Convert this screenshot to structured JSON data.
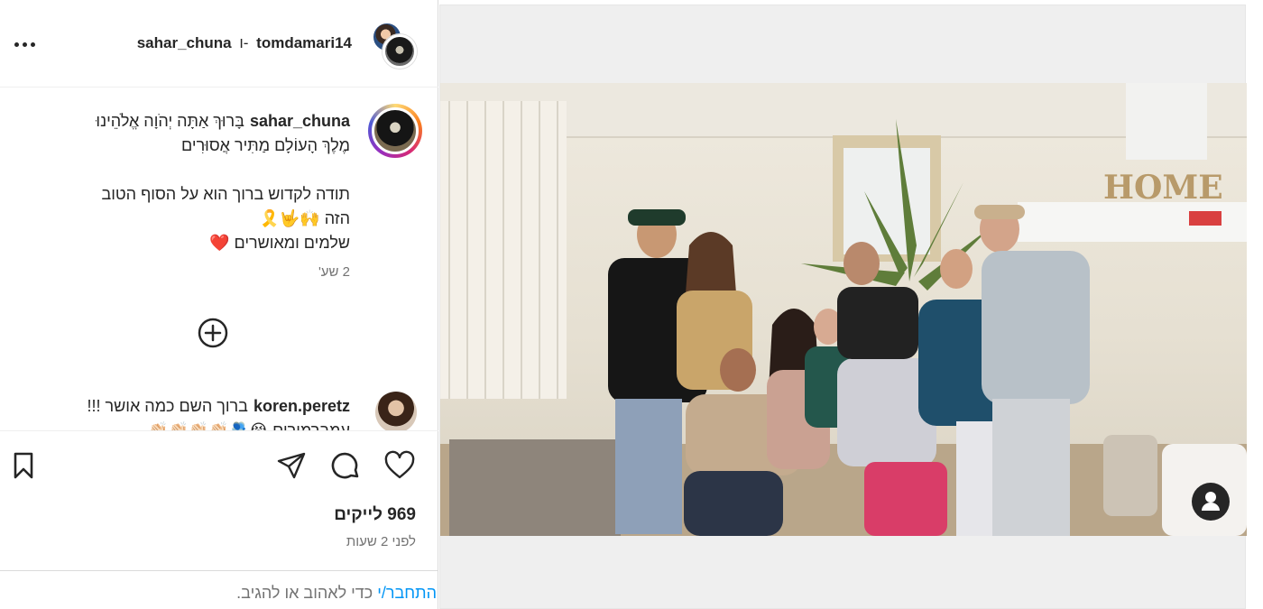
{
  "post": {
    "header": {
      "user1": "sahar_chuna",
      "separator": "ו-",
      "user2": "tomdamari14"
    },
    "caption": {
      "username": "sahar_chuna",
      "line1": "בָּרוּךְ אַתָּה יְהֹוָה אֱלֹהֵינוּ",
      "line2": "מֶלֶךְ הָעוֹלָם מַתִּיר אֲסוּרִים",
      "line3": "תודה לקדוש ברוך הוא על הסוף הטוב",
      "line4": "הזה 🙌🤟🎗️",
      "line5": "שלמים ומאושרים ❤️",
      "time": "2 שע'"
    },
    "comment": {
      "username": "koren.peretz",
      "text": "ברוך השם כמה אושר !!!",
      "text2": "עמברמורים 😭🫂👏🏻👏🏻👏🏻👏🏻"
    },
    "likes": "969 לייקים",
    "posted": "לפני 2 שעות",
    "login": {
      "link": "התחבר/י",
      "rest": " כדי לאהוב או להגיב."
    }
  },
  "icons": {
    "more": "more-options-icon",
    "add_comments": "plus-circle-icon",
    "bookmark": "bookmark-icon",
    "share": "paper-plane-icon",
    "comment": "speech-bubble-icon",
    "like": "heart-icon",
    "tags": "person-icon"
  },
  "colors": {
    "link": "#0095f6",
    "text": "#262626",
    "muted": "#737373"
  }
}
